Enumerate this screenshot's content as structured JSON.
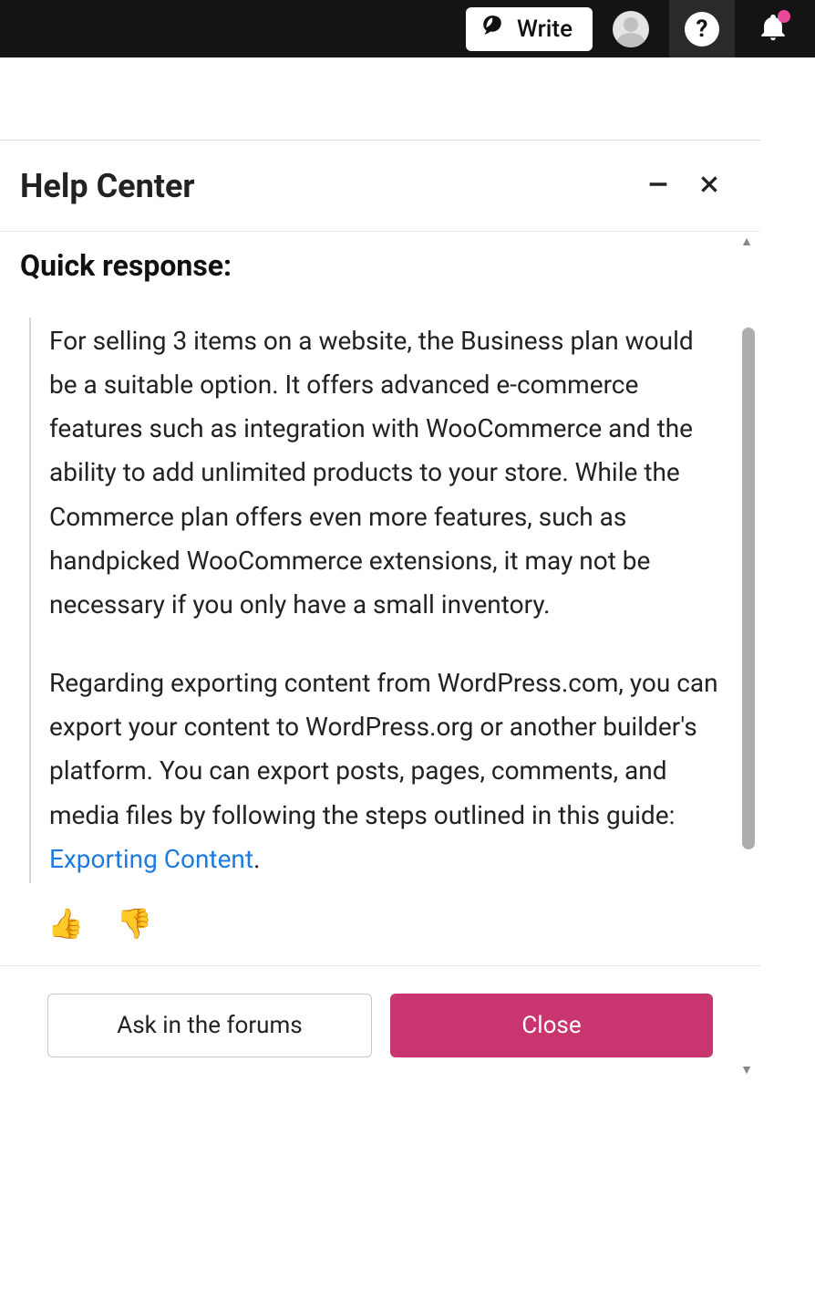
{
  "topbar": {
    "write_label": "Write",
    "help_char": "?"
  },
  "panel": {
    "title": "Help Center",
    "quick_response_heading": "Quick response:",
    "response_para1": "For selling 3 items on a website, the Business plan would be a suitable option. It offers advanced e-commerce features such as integration with WooCommerce and the ability to add unlimited products to your store. While the Commerce plan offers even more features, such as handpicked WooCommerce extensions, it may not be necessary if you only have a small inventory.",
    "response_para2_pre": "Regarding exporting content from WordPress.com, you can export your content to WordPress.org or another builder's platform. You can export posts, pages, comments, and media files by following the steps outlined in this guide: ",
    "response_link_text": "Exporting Content",
    "response_para2_post": ".",
    "feedback_thumbs_up": "👍",
    "feedback_thumbs_down": "👎",
    "footer_ask_label": "Ask in the forums",
    "footer_close_label": "Close",
    "scroll_up_glyph": "▲",
    "scroll_down_glyph": "▼"
  }
}
